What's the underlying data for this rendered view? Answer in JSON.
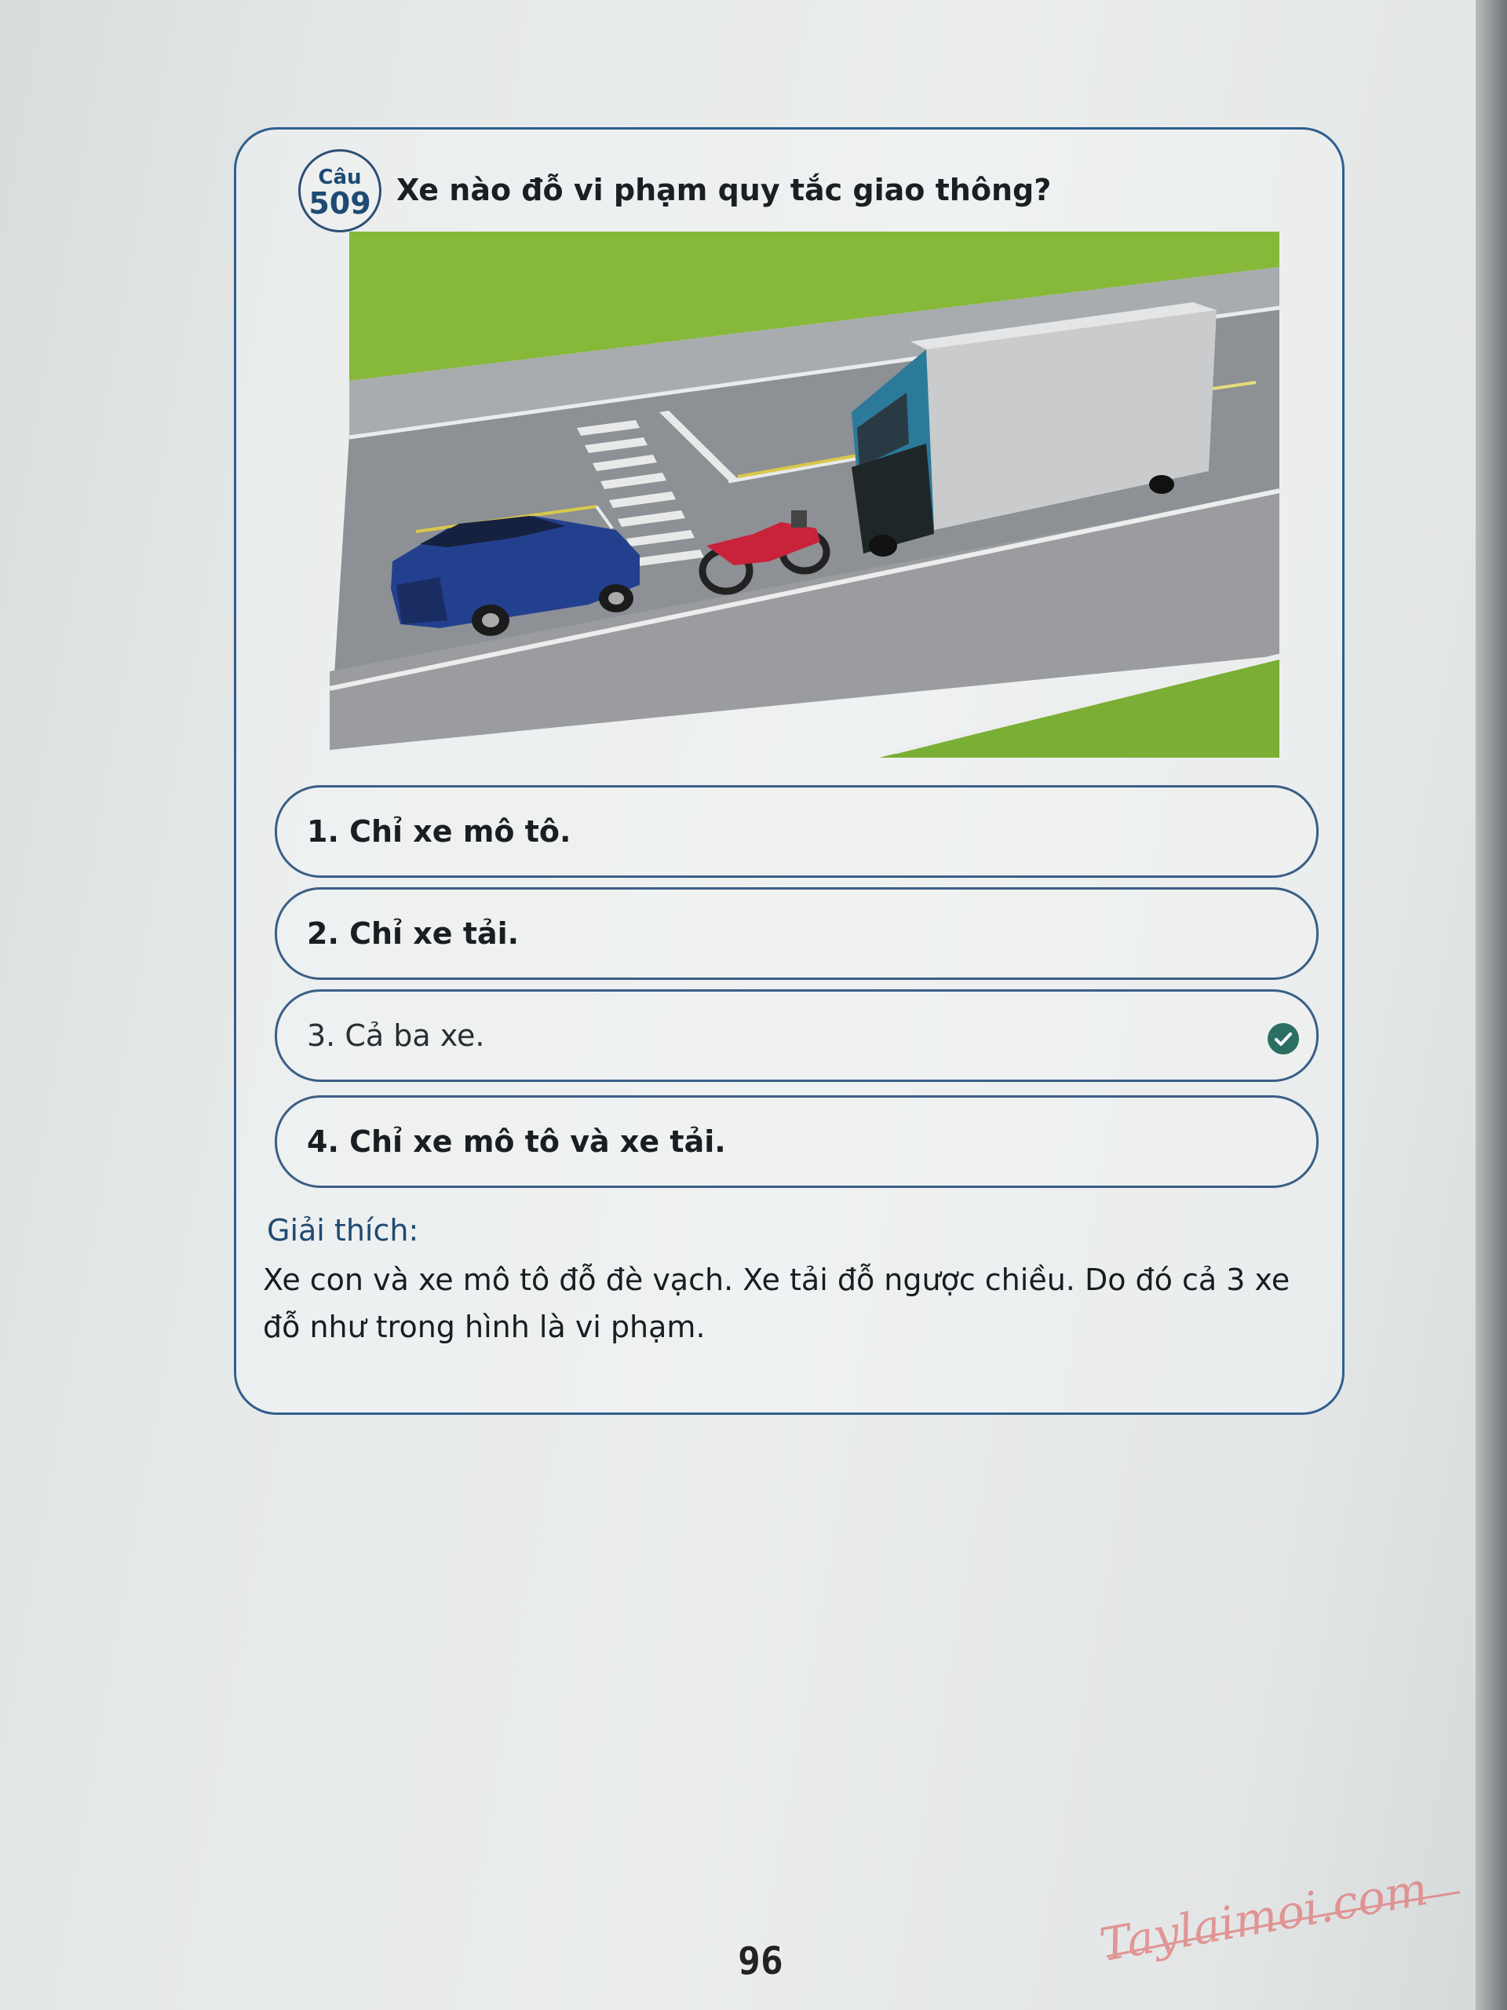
{
  "question": {
    "badge_label": "Câu",
    "number": "509",
    "text": "Xe nào đỗ vi phạm quy tắc giao thông?"
  },
  "options": [
    {
      "label": "1. Chỉ xe mô tô.",
      "correct": false
    },
    {
      "label": "2. Chỉ xe tải.",
      "correct": false
    },
    {
      "label": "3. Cả ba xe.",
      "correct": true
    },
    {
      "label": "4. Chỉ xe mô tô và xe tải.",
      "correct": false
    }
  ],
  "explanation": {
    "label": "Giải thích:",
    "text": "Xe con và xe mô tô đỗ đè vạch. Xe tải đỗ ngược chiều. Do đó cả 3 xe đỗ như trong hình là vi phạm."
  },
  "page_number": "96",
  "watermark": {
    "text": "Taylaimoi.com"
  },
  "colors": {
    "accent": "#1e4a74",
    "correct_check": "#2b6f63",
    "grass": "#86b83a",
    "road": "#8d9094"
  }
}
